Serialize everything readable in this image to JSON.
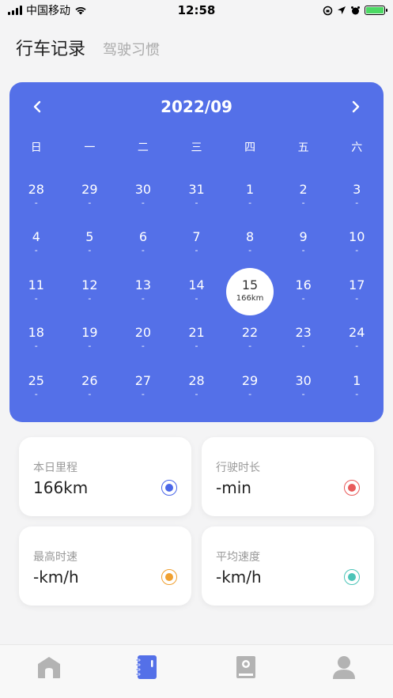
{
  "status": {
    "carrier": "中国移动",
    "time": "12:58"
  },
  "header": {
    "tabs": [
      {
        "label": "行车记录"
      },
      {
        "label": "驾驶习惯"
      }
    ]
  },
  "calendar": {
    "title": "2022/09",
    "weekdays": [
      "日",
      "一",
      "二",
      "三",
      "四",
      "五",
      "六"
    ],
    "days": [
      {
        "num": "28",
        "sub": "-"
      },
      {
        "num": "29",
        "sub": "-"
      },
      {
        "num": "30",
        "sub": "-"
      },
      {
        "num": "31",
        "sub": "-"
      },
      {
        "num": "1",
        "sub": "-"
      },
      {
        "num": "2",
        "sub": "-"
      },
      {
        "num": "3",
        "sub": "-"
      },
      {
        "num": "4",
        "sub": "-"
      },
      {
        "num": "5",
        "sub": "-"
      },
      {
        "num": "6",
        "sub": "-"
      },
      {
        "num": "7",
        "sub": "-"
      },
      {
        "num": "8",
        "sub": "-"
      },
      {
        "num": "9",
        "sub": "-"
      },
      {
        "num": "10",
        "sub": "-"
      },
      {
        "num": "11",
        "sub": "-"
      },
      {
        "num": "12",
        "sub": "-"
      },
      {
        "num": "13",
        "sub": "-"
      },
      {
        "num": "14",
        "sub": "-"
      },
      {
        "num": "15",
        "sub": "166km",
        "selected": true
      },
      {
        "num": "16",
        "sub": "-"
      },
      {
        "num": "17",
        "sub": "-"
      },
      {
        "num": "18",
        "sub": "-"
      },
      {
        "num": "19",
        "sub": "-"
      },
      {
        "num": "20",
        "sub": "-"
      },
      {
        "num": "21",
        "sub": "-"
      },
      {
        "num": "22",
        "sub": "-"
      },
      {
        "num": "23",
        "sub": "-"
      },
      {
        "num": "24",
        "sub": "-"
      },
      {
        "num": "25",
        "sub": "-"
      },
      {
        "num": "26",
        "sub": "-"
      },
      {
        "num": "27",
        "sub": "-"
      },
      {
        "num": "28",
        "sub": "-"
      },
      {
        "num": "29",
        "sub": "-"
      },
      {
        "num": "30",
        "sub": "-"
      },
      {
        "num": "1",
        "sub": "-"
      }
    ]
  },
  "stats": [
    {
      "label": "本日里程",
      "value": "166km",
      "color": "#4a66e8"
    },
    {
      "label": "行驶时长",
      "value": "-min",
      "color": "#e85a5a"
    },
    {
      "label": "最高时速",
      "value": "-km/h",
      "color": "#f0a030"
    },
    {
      "label": "平均速度",
      "value": "-km/h",
      "color": "#4cc4b8"
    }
  ],
  "colors": {
    "accent": "#5470e8",
    "tab_inactive": "#b3b3b3"
  },
  "tabbar": [
    {
      "icon": "home-icon"
    },
    {
      "icon": "record-book-icon",
      "active": true
    },
    {
      "icon": "manual-book-icon"
    },
    {
      "icon": "profile-icon"
    }
  ]
}
